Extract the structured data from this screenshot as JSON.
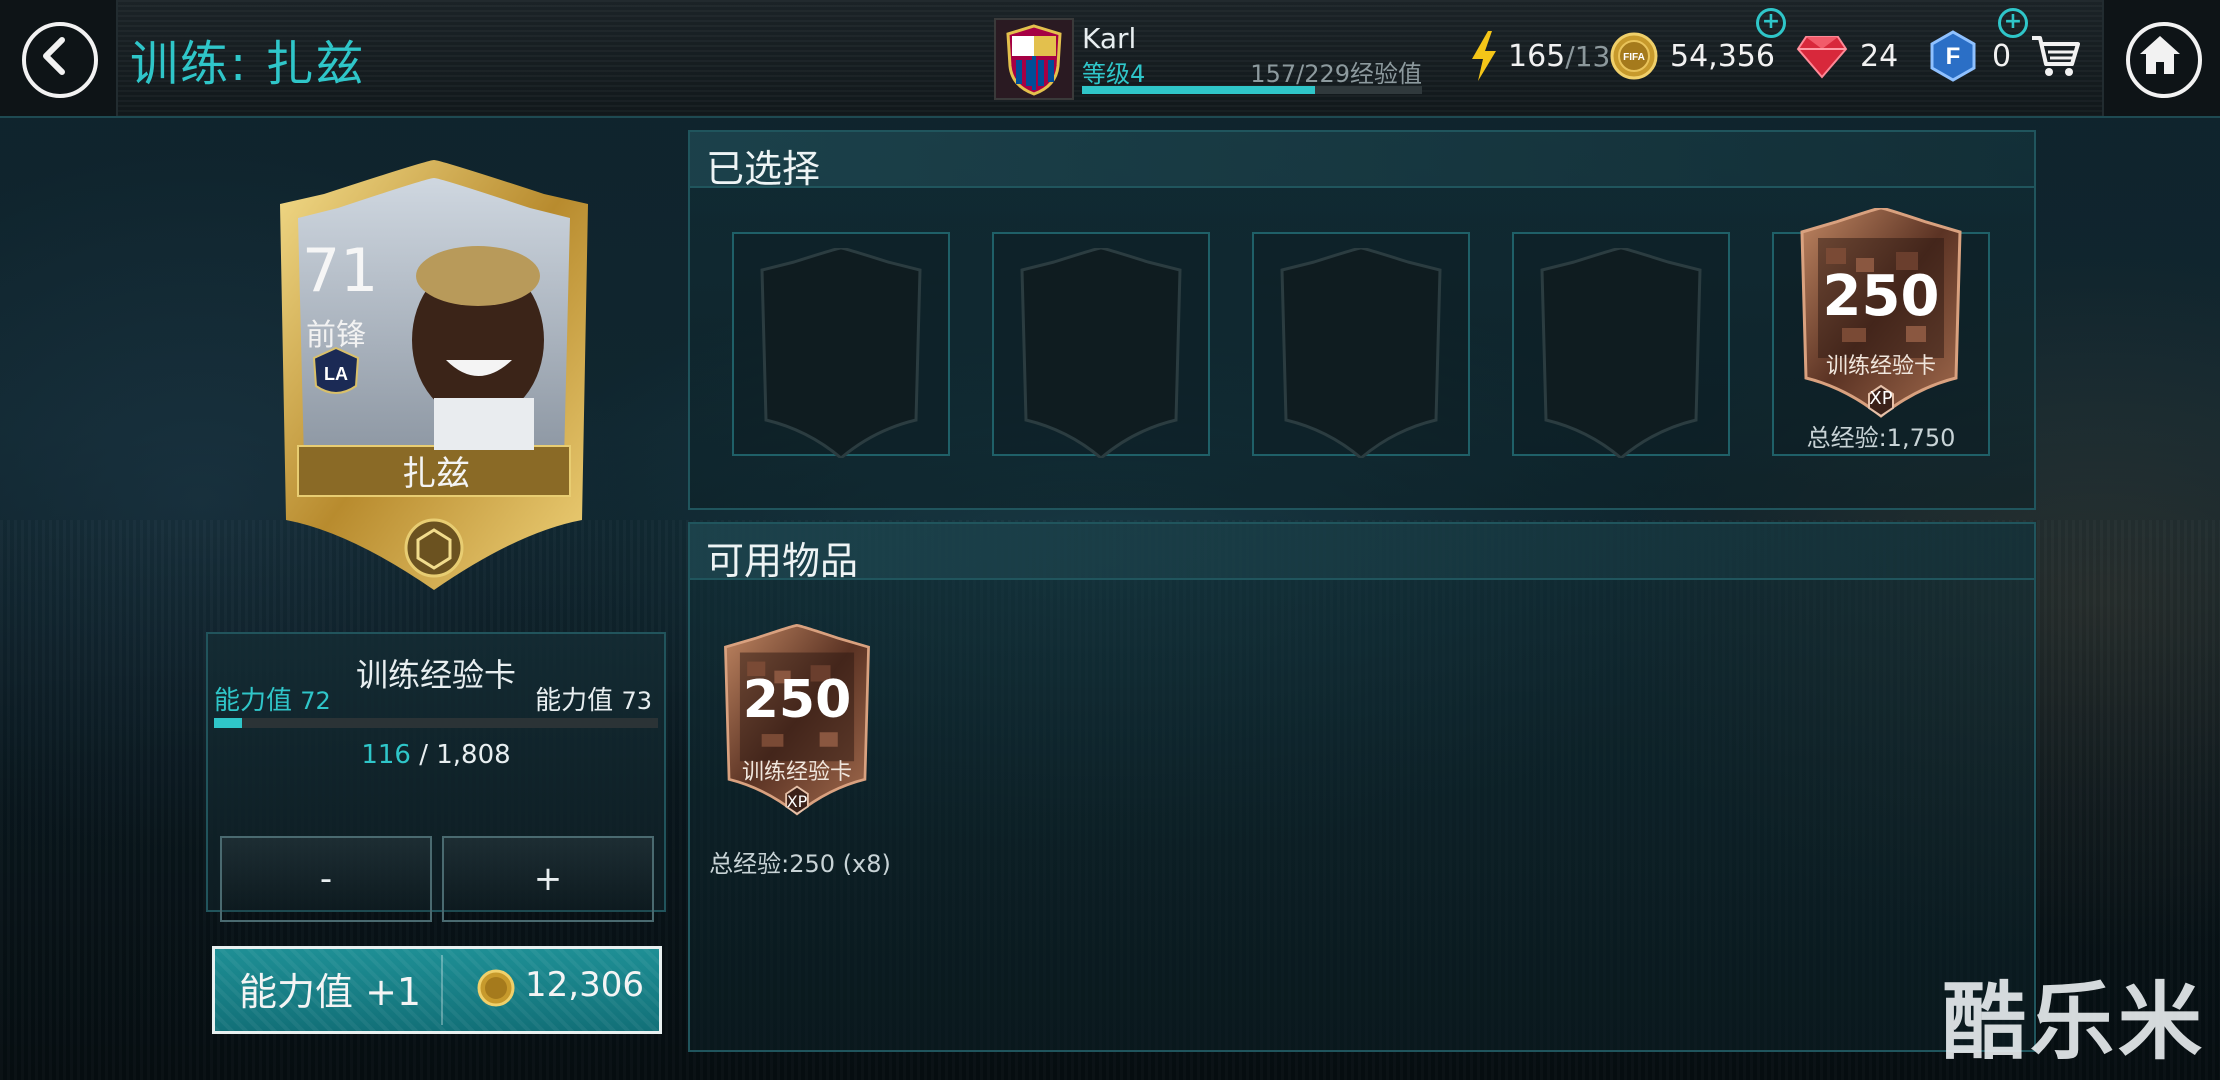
{
  "header": {
    "title": "训练: 扎兹",
    "user": {
      "name": "Karl",
      "level": "等级4",
      "xp_text": "157/229经验值",
      "xp_progress": 0.686
    },
    "resources": {
      "energy": "165",
      "energy_max": "/13",
      "coins": "54,356",
      "gems": "24",
      "fifa_points": "0"
    }
  },
  "player": {
    "rating": "71",
    "position": "前锋",
    "name": "扎兹",
    "club_badge": "LA"
  },
  "training": {
    "title": "训练经验卡",
    "ovr_left_label": "能力值",
    "ovr_left_value": "72",
    "ovr_right_label": "能力值",
    "ovr_right_value": "73",
    "progress_current": "116",
    "progress_sep": "/",
    "progress_max": "1,808",
    "progress_fraction": 0.064,
    "minus_label": "-",
    "plus_label": "+"
  },
  "upgrade_button": {
    "label": "能力值 +1",
    "cost": "12,306"
  },
  "selected": {
    "title": "已选择",
    "empty_slots": 4,
    "card": {
      "value": "250",
      "label": "训练经验卡",
      "badge": "XP",
      "total": "总经验:1,750"
    }
  },
  "available": {
    "title": "可用物品",
    "items": [
      {
        "value": "250",
        "label": "训练经验卡",
        "badge": "XP",
        "total": "总经验:250 (x8)"
      }
    ]
  },
  "watermark": "酷乐米",
  "icons": {
    "back": "chevron-left-icon",
    "home": "home-icon",
    "energy": "lightning-icon",
    "coins": "coin-icon",
    "gems": "gem-icon",
    "points": "fifa-points-icon",
    "cart": "cart-icon"
  },
  "colors": {
    "accent": "#2fc6c9",
    "gold": "#c8a24a",
    "bronze": "#a0674a"
  }
}
